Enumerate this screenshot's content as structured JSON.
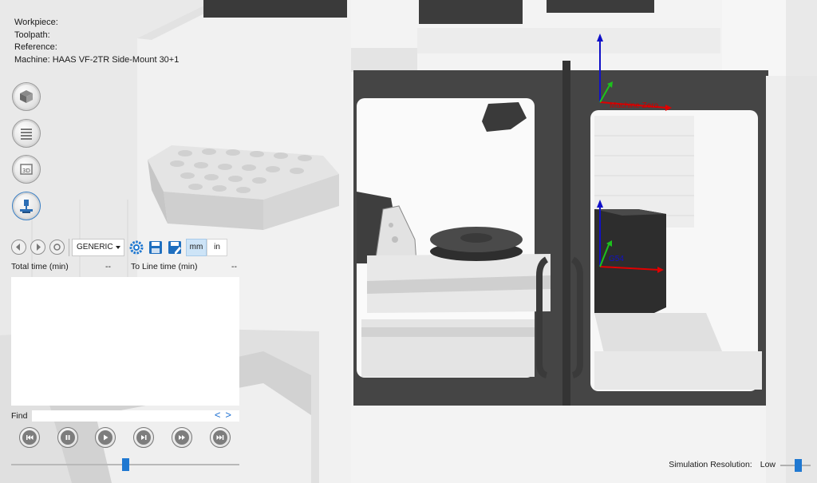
{
  "info": {
    "workpiece": "Workpiece:",
    "toolpath": "Toolpath:",
    "reference": "Reference:",
    "machine": "Machine: HAAS VF-2TR Side-Mount 30+1"
  },
  "side_icons": [
    "workpiece-icon",
    "toolpath-list-icon",
    "3d-view-icon",
    "machine-icon"
  ],
  "toolbar": {
    "post_select": "GENERIC",
    "unit_mm": "mm",
    "unit_in": "in",
    "active_unit": "mm"
  },
  "times": {
    "total_label": "Total time (min)",
    "total_value": "--",
    "line_label": "To Line time (min)",
    "line_value": "--"
  },
  "find": {
    "label": "Find",
    "prev": "<",
    "next": ">"
  },
  "playback": [
    "rewind-to-start",
    "pause",
    "play",
    "step-forward",
    "fast-forward",
    "skip-to-end"
  ],
  "simulation_progress": 0.5,
  "simulation_resolution": {
    "label": "Simulation Resolution:",
    "value": "Low"
  },
  "scene_labels": {
    "machine_zero": "Machine Zero",
    "work_offset": "G54"
  },
  "colors": {
    "accent": "#1f78d1",
    "axis_x": "#e00000",
    "axis_y": "#1cc21c",
    "axis_z": "#1010c8",
    "machine_dark": "#444444"
  }
}
